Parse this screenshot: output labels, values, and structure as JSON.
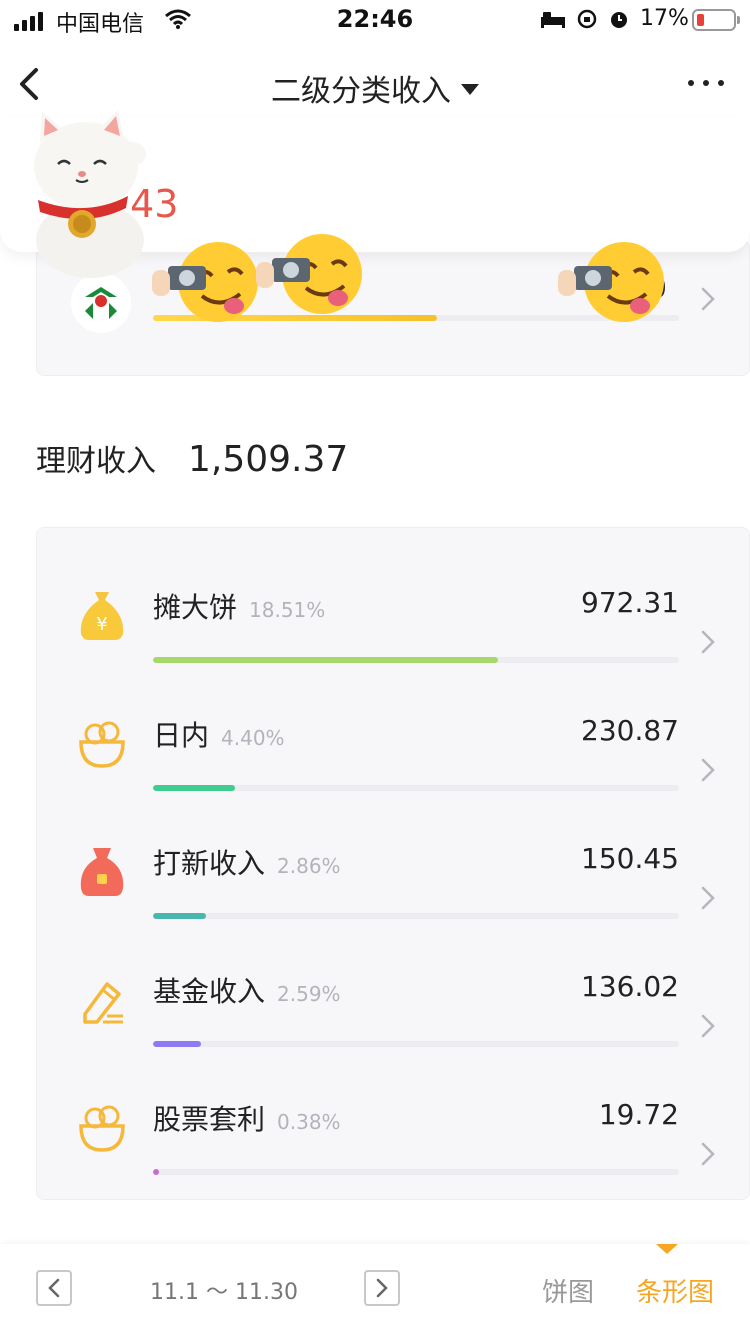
{
  "status_bar": {
    "carrier": "中国电信",
    "time": "22:46",
    "battery_pct": "17%"
  },
  "nav": {
    "title": "二级分类收入"
  },
  "summary": {
    "amount_partial": ".43"
  },
  "prev_group": {
    "value_partial": "0",
    "bar_fraction": 0.54,
    "bar_color": "#f6c12a"
  },
  "section": {
    "label": "理财收入",
    "total": "1,509.37"
  },
  "items": [
    {
      "name": "摊大饼",
      "pct": "18.51%",
      "value": "972.31",
      "icon": "money-bag-icon",
      "fraction": 0.656,
      "color": "#a7d96a"
    },
    {
      "name": "日内",
      "pct": "4.40%",
      "value": "230.87",
      "icon": "coin-bowl-icon",
      "fraction": 0.156,
      "color": "#3ecc8f"
    },
    {
      "name": "打新收入",
      "pct": "2.86%",
      "value": "150.45",
      "icon": "red-pouch-icon",
      "fraction": 0.101,
      "color": "#49b7b0"
    },
    {
      "name": "基金收入",
      "pct": "2.59%",
      "value": "136.02",
      "icon": "pencil-note-icon",
      "fraction": 0.092,
      "color": "#8c7bf2"
    },
    {
      "name": "股票套利",
      "pct": "0.38%",
      "value": "19.72",
      "icon": "coin-bowl-icon",
      "fraction": 0.012,
      "color": "#c86ad6"
    }
  ],
  "bottom_bar": {
    "range": "11.1 ～ 11.30",
    "tab_pie": "饼图",
    "tab_bar": "条形图",
    "active_color": "#f5a623"
  }
}
